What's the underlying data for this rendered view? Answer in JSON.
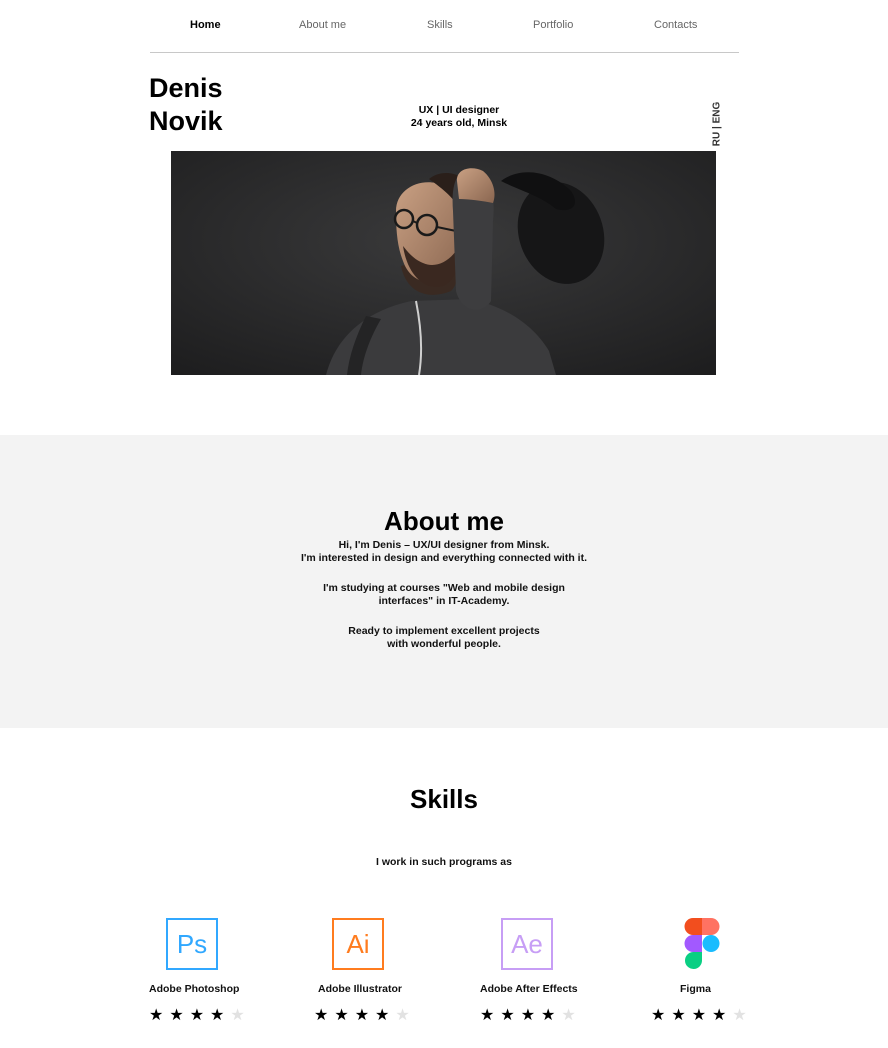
{
  "nav": {
    "items": [
      {
        "label": "Home",
        "active": true
      },
      {
        "label": "About me",
        "active": false
      },
      {
        "label": "Skills",
        "active": false
      },
      {
        "label": "Portfolio",
        "active": false
      },
      {
        "label": "Contacts",
        "active": false
      }
    ]
  },
  "hero": {
    "first_name": "Denis",
    "last_name": "Novik",
    "role": "UX | UI designer",
    "age_city": "24 years old, Minsk",
    "language_switch": "RU | ENG"
  },
  "about": {
    "title": "About me",
    "paragraphs": [
      [
        "Hi, I'm Denis – UX/UI designer from Minsk.",
        "I'm interested in design and everything connected with it."
      ],
      [
        "I'm studying at courses \"Web and mobile design",
        "interfaces\" in IT-Academy."
      ],
      [
        "Ready to implement excellent projects",
        "with wonderful people."
      ]
    ]
  },
  "skills": {
    "title": "Skills",
    "subtitle": "I work in such programs as",
    "items": [
      {
        "name": "Adobe Photoshop",
        "logo_text": "Ps",
        "icon": "photoshop-icon",
        "color": "#31a8ff",
        "rating": 4,
        "max": 5
      },
      {
        "name": "Adobe Illustrator",
        "logo_text": "Ai",
        "icon": "illustrator-icon",
        "color": "#ff7c1f",
        "rating": 4,
        "max": 5
      },
      {
        "name": "Adobe After Effects",
        "logo_text": "Ae",
        "icon": "after-effects-icon",
        "color": "#c79ef5",
        "rating": 4,
        "max": 5
      },
      {
        "name": "Figma",
        "logo_text": "",
        "icon": "figma-icon",
        "color": "#f24e1e",
        "rating": 4,
        "max": 5
      }
    ]
  }
}
